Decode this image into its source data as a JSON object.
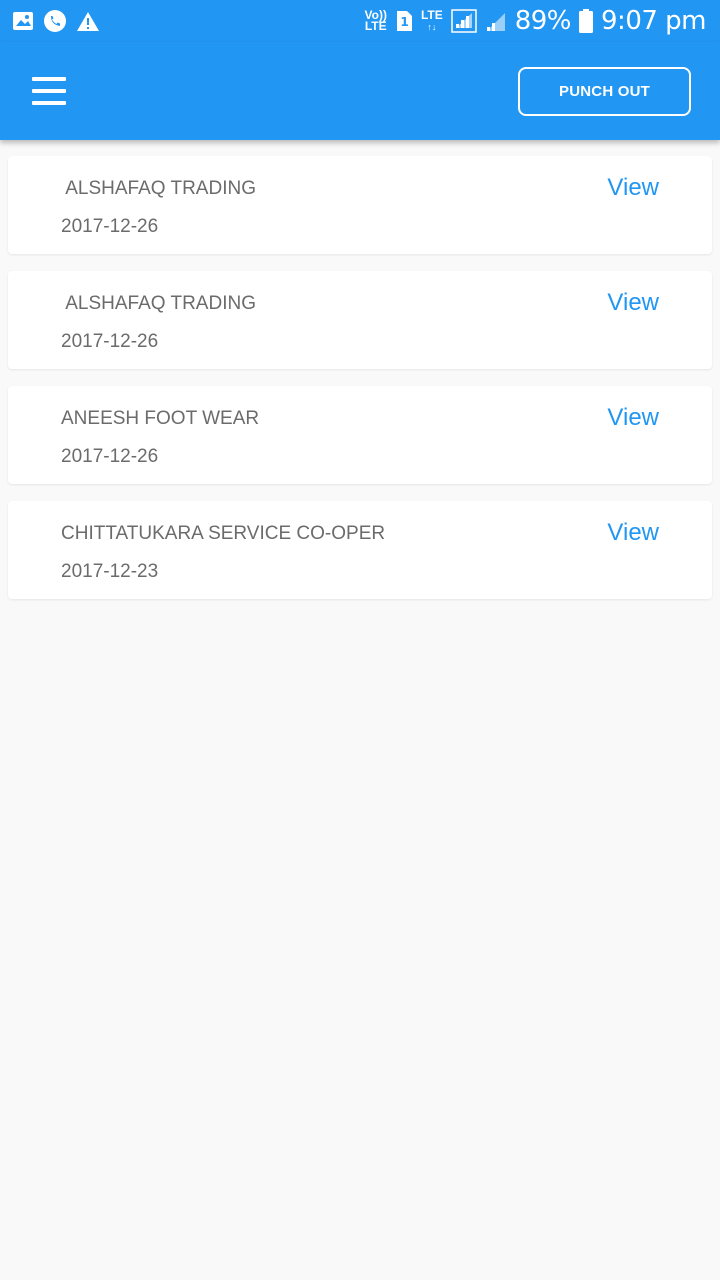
{
  "status_bar": {
    "network_top": "Vo))",
    "network_bottom": "LTE",
    "sim": "1",
    "lte": "LTE",
    "battery": "89%",
    "time": "9:07 pm",
    "icons": [
      "image-icon",
      "phone-icon",
      "warning-icon",
      "signal-icon",
      "battery-icon"
    ]
  },
  "app_bar": {
    "punch_out_label": "PUNCH OUT",
    "menu_icon": "hamburger-menu-icon"
  },
  "colors": {
    "primary": "#2196f3",
    "text_muted": "#6b6b6b",
    "background": "#f9f9f9"
  },
  "items": [
    {
      "title": " ALSHAFAQ TRADING",
      "date": "2017-12-26",
      "action": "View"
    },
    {
      "title": " ALSHAFAQ TRADING",
      "date": "2017-12-26",
      "action": "View"
    },
    {
      "title": "ANEESH FOOT WEAR",
      "date": "2017-12-26",
      "action": "View"
    },
    {
      "title": "CHITTATUKARA SERVICE CO-OPER",
      "date": "2017-12-23",
      "action": "View"
    }
  ]
}
